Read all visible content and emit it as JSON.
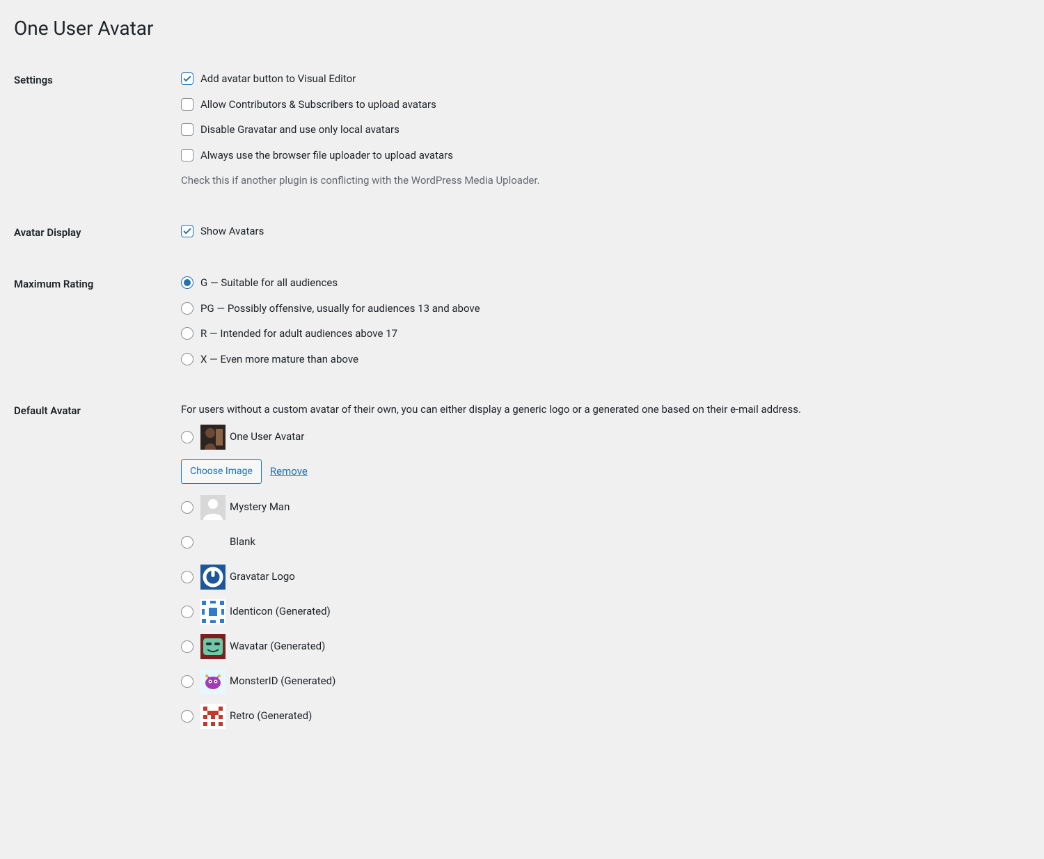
{
  "page_title": "One User Avatar",
  "sections": {
    "settings": {
      "heading": "Settings",
      "options": [
        {
          "label": "Add avatar button to Visual Editor",
          "checked": true
        },
        {
          "label": "Allow Contributors & Subscribers to upload avatars",
          "checked": false
        },
        {
          "label": "Disable Gravatar and use only local avatars",
          "checked": false
        },
        {
          "label": "Always use the browser file uploader to upload avatars",
          "checked": false
        }
      ],
      "description": "Check this if another plugin is conflicting with the WordPress Media Uploader."
    },
    "avatar_display": {
      "heading": "Avatar Display",
      "option": {
        "label": "Show Avatars",
        "checked": true
      }
    },
    "max_rating": {
      "heading": "Maximum Rating",
      "options": [
        {
          "label": "G — Suitable for all audiences",
          "checked": true
        },
        {
          "label": "PG — Possibly offensive, usually for audiences 13 and above",
          "checked": false
        },
        {
          "label": "R — Intended for adult audiences above 17",
          "checked": false
        },
        {
          "label": "X — Even more mature than above",
          "checked": false
        }
      ]
    },
    "default_avatar": {
      "heading": "Default Avatar",
      "description": "For users without a custom avatar of their own, you can either display a generic logo or a generated one based on their e-mail address.",
      "choose_image_label": "Choose Image",
      "remove_label": "Remove",
      "options": [
        {
          "label": "One User Avatar",
          "checked": false,
          "icon": "photo"
        },
        {
          "label": "Mystery Man",
          "checked": false,
          "icon": "mystery"
        },
        {
          "label": "Blank",
          "checked": false,
          "icon": "blank"
        },
        {
          "label": "Gravatar Logo",
          "checked": false,
          "icon": "gravatar"
        },
        {
          "label": "Identicon (Generated)",
          "checked": false,
          "icon": "identicon"
        },
        {
          "label": "Wavatar (Generated)",
          "checked": false,
          "icon": "wavatar"
        },
        {
          "label": "MonsterID (Generated)",
          "checked": false,
          "icon": "monster"
        },
        {
          "label": "Retro (Generated)",
          "checked": false,
          "icon": "retro"
        }
      ]
    }
  }
}
